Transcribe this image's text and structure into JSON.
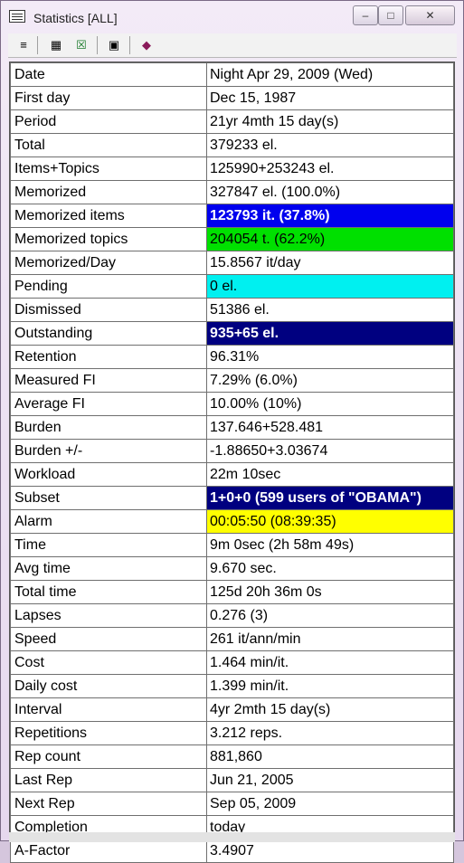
{
  "window": {
    "title": "Statistics [ALL]",
    "controls": {
      "minimize": "–",
      "maximize": "□",
      "close": "✕"
    }
  },
  "toolbar": {
    "buttons": [
      {
        "icon": "list-icon",
        "glyph": "≡"
      },
      {
        "icon": "calendar-icon",
        "glyph": "▦"
      },
      {
        "icon": "excel-icon",
        "glyph": "☒"
      },
      {
        "icon": "save-icon",
        "glyph": "▣"
      },
      {
        "icon": "book-icon",
        "glyph": "◆"
      }
    ]
  },
  "colors": {
    "blue": "#0000ee",
    "green": "#00e000",
    "cyan": "#00f0f0",
    "navy": "#000080",
    "yellow": "#ffff00"
  },
  "stats": [
    {
      "label": "Date",
      "value": "Night Apr 29, 2009 (Wed)"
    },
    {
      "label": "First day",
      "value": "Dec 15, 1987"
    },
    {
      "label": "Period",
      "value": "21yr 4mth 15 day(s)"
    },
    {
      "label": "Total",
      "value": "379233 el."
    },
    {
      "label": "Items+Topics",
      "value": "125990+253243 el."
    },
    {
      "label": "Memorized",
      "value": "327847 el. (100.0%)"
    },
    {
      "label": "Memorized items",
      "value": "123793 it. (37.8%)"
    },
    {
      "label": "Memorized topics",
      "value": "204054 t. (62.2%)"
    },
    {
      "label": "Memorized/Day",
      "value": "15.8567 it/day"
    },
    {
      "label": "Pending",
      "value": "0 el."
    },
    {
      "label": "Dismissed",
      "value": "51386 el."
    },
    {
      "label": "Outstanding",
      "value": "935+65 el."
    },
    {
      "label": "Retention",
      "value": "96.31%"
    },
    {
      "label": "Measured FI",
      "value": "7.29% (6.0%)"
    },
    {
      "label": "Average FI",
      "value": "10.00% (10%)"
    },
    {
      "label": "Burden",
      "value": "137.646+528.481"
    },
    {
      "label": "Burden +/-",
      "value": "-1.88650+3.03674"
    },
    {
      "label": "Workload",
      "value": "22m 10sec"
    },
    {
      "label": "Subset",
      "value": "1+0+0 (599 users of \"OBAMA\")"
    },
    {
      "label": "Alarm",
      "value": "00:05:50 (08:39:35)"
    },
    {
      "label": "Time",
      "value": "9m 0sec (2h 58m 49s)"
    },
    {
      "label": "Avg time",
      "value": "9.670 sec."
    },
    {
      "label": "Total time",
      "value": "125d 20h 36m 0s"
    },
    {
      "label": "Lapses",
      "value": "0.276 (3)"
    },
    {
      "label": "Speed",
      "value": "261 it/ann/min"
    },
    {
      "label": "Cost",
      "value": "1.464 min/it."
    },
    {
      "label": "Daily cost",
      "value": "1.399 min/it."
    },
    {
      "label": "Interval",
      "value": "4yr 2mth 15 day(s)"
    },
    {
      "label": "Repetitions",
      "value": "3.212 reps."
    },
    {
      "label": "Rep count",
      "value": "881,860"
    },
    {
      "label": "Last Rep",
      "value": "Jun 21, 2005"
    },
    {
      "label": "Next Rep",
      "value": "Sep 05, 2009"
    },
    {
      "label": "Completion",
      "value": "today"
    },
    {
      "label": "A-Factor",
      "value": "3.4907"
    }
  ]
}
